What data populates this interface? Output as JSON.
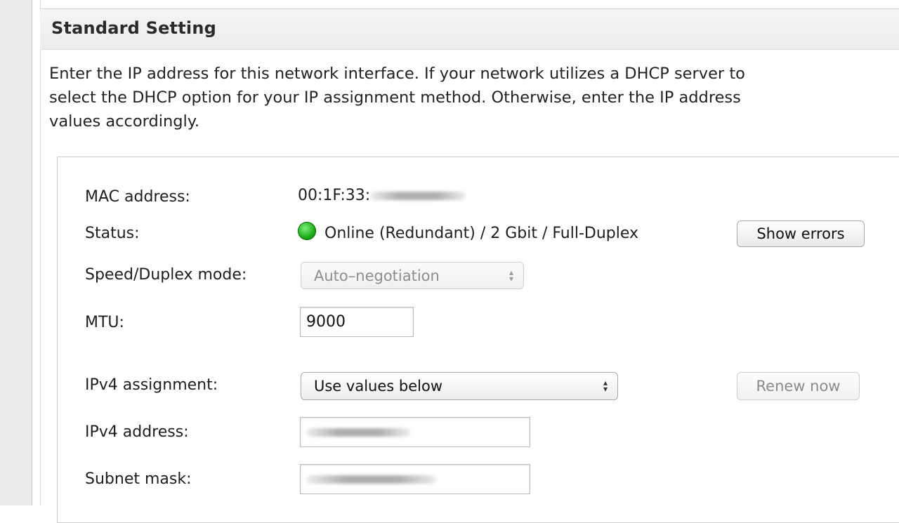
{
  "section": {
    "title": "Standard Setting",
    "intro_lines": [
      "Enter the IP address for this network interface. If your network utilizes a DHCP server to",
      "select the DHCP option for your IP assignment method. Otherwise, enter the IP address",
      "values accordingly."
    ]
  },
  "form": {
    "mac": {
      "label": "MAC address:",
      "value_visible": "00:1F:33:"
    },
    "status": {
      "label": "Status:",
      "value": "Online (Redundant) / 2 Gbit / Full-Duplex",
      "indicator_color": "#1fae1a",
      "show_errors_label": "Show errors"
    },
    "speed": {
      "label": "Speed/Duplex mode:",
      "selected": "Auto–negotiation"
    },
    "mtu": {
      "label": "MTU:",
      "value": "9000"
    },
    "ipv4_assignment": {
      "label": "IPv4 assignment:",
      "selected": "Use values below",
      "renew_label": "Renew now"
    },
    "ipv4_address": {
      "label": "IPv4 address:"
    },
    "subnet_mask": {
      "label": "Subnet mask:"
    }
  },
  "icons": {
    "select_arrows": "up-down-arrows-icon",
    "status_indicator": "green-status-dot-icon"
  }
}
